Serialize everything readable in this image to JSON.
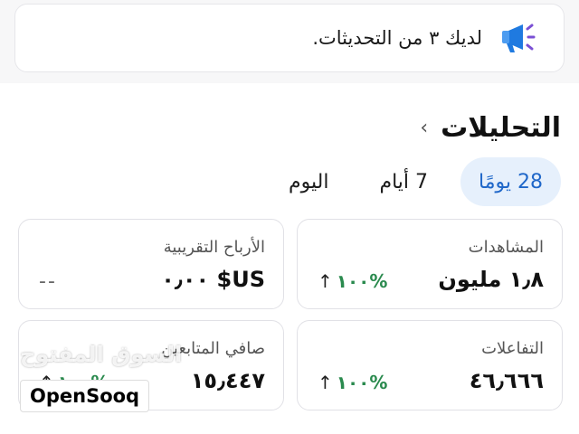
{
  "notice": {
    "text": "لديك ٣ من التحديثات.",
    "icon": "megaphone-icon"
  },
  "analytics": {
    "title": "التحليلات",
    "chevron": "›"
  },
  "tabs": [
    {
      "label": "28 يومًا",
      "active": true
    },
    {
      "label": "7 أيام",
      "active": false
    },
    {
      "label": "اليوم",
      "active": false
    }
  ],
  "cards": {
    "views": {
      "label": "المشاهدات",
      "value": "١٫٨ مليون",
      "change": "١٠٠%",
      "arrow": "↑"
    },
    "earnings": {
      "label": "الأرباح التقريبية",
      "value": "US$ ٠٫٠٠",
      "change": "--"
    },
    "interactions": {
      "label": "التفاعلات",
      "value": "٤٦٫٦٦٦",
      "change": "١٠٠%",
      "arrow": "↑"
    },
    "followers": {
      "label": "صافي المتابعين",
      "value": "١٥٫٤٤٧",
      "change": "١٠٠%",
      "arrow": "↑"
    }
  },
  "watermark": {
    "arabic": "السوق المفتوح",
    "logo": "OpenSooq"
  },
  "colors": {
    "accent": "#1f67c9",
    "tab_active_bg": "#e6f0fc",
    "positive": "#2a8a4e"
  }
}
